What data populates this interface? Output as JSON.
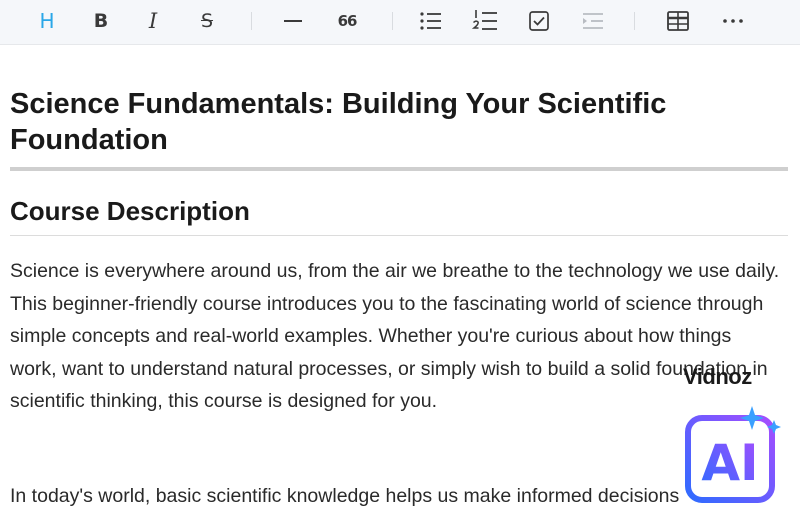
{
  "toolbar": {
    "heading_label": "H",
    "bold_label": "B",
    "italic_label": "I",
    "strike_label": "S",
    "quote_label": "66"
  },
  "document": {
    "title": "Science Fundamentals: Building Your Scientific Foundation",
    "section_heading": "Course Description",
    "paragraph_1": "Science is everywhere around us, from the air we breathe to the technology we use daily. This beginner-friendly course introduces you to the fascinating world of science through simple concepts and real-world examples. Whether you're curious about how things work, want to understand natural processes, or simply wish to build a solid foundation in scientific thinking, this course is designed for you.",
    "paragraph_2": "In today's world, basic scientific knowledge helps us make informed decisions"
  },
  "watermark": {
    "brand": "Vidnoz",
    "badge": "AI"
  },
  "colors": {
    "heading_active": "#2aa7e8",
    "watermark_gradient_start": "#2f6bff",
    "watermark_gradient_end": "#a64dff"
  }
}
